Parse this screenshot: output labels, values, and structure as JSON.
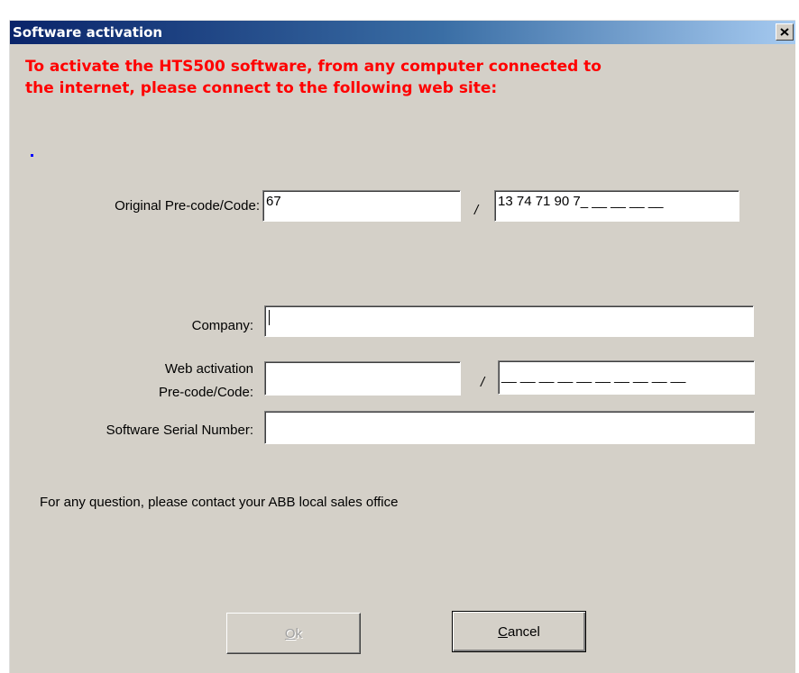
{
  "window": {
    "title": "Software activation",
    "close_glyph": "x",
    "close_icon": "close-icon"
  },
  "instruction": {
    "line1": "To activate the HTS500 software, from any computer connected to",
    "line2": "the internet, please connect to the following web site:"
  },
  "original_code": {
    "label": "Original Pre-code/Code:",
    "precode_value": "67",
    "separator": "/",
    "code_value": "13 74 71 90 7_ __ __ __ __"
  },
  "company": {
    "label": "Company:",
    "value": ""
  },
  "web_activation": {
    "label_line1": "Web activation",
    "label_line2": "Pre-code/Code:",
    "precode_value": "",
    "separator": "/",
    "code_value": "__ __ __ __ __ __ __ __ __ __"
  },
  "serial": {
    "label": "Software Serial Number:",
    "value": ""
  },
  "contact_text": "For any question, please contact your ABB local sales office",
  "buttons": {
    "ok": {
      "mnemonic": "O",
      "rest": "k",
      "enabled": false
    },
    "cancel": {
      "mnemonic": "C",
      "rest": "ancel",
      "enabled": true
    }
  },
  "colors": {
    "instruction_text": "#ff0000",
    "dialog_background": "#d4d0c8",
    "titlebar_start": "#0a246a",
    "titlebar_end": "#a6caf0"
  }
}
